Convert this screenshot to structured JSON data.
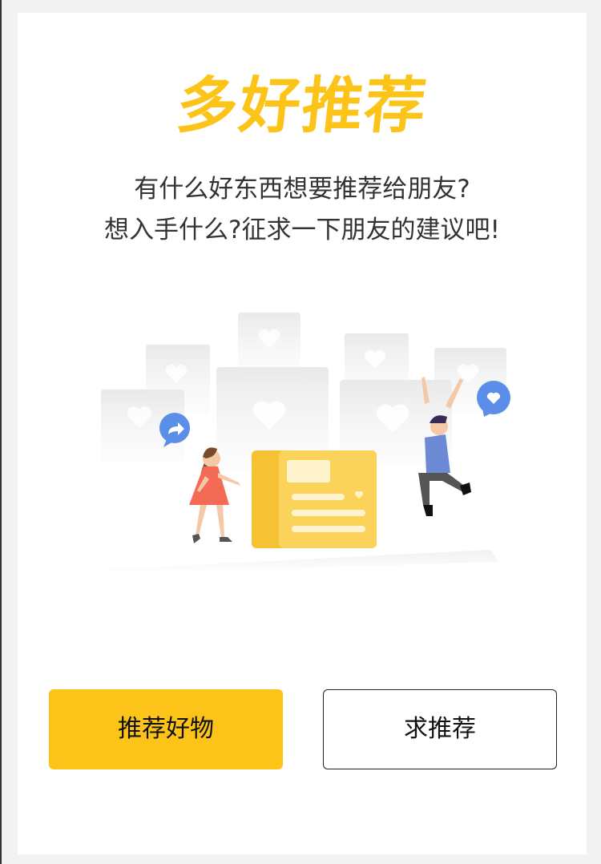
{
  "title": "多好推荐",
  "subtitle_line1": "有什么好东西想要推荐给朋友?",
  "subtitle_line2": "想入手什么?征求一下朋友的建议吧!",
  "buttons": {
    "recommend": "推荐好物",
    "ask": "求推荐"
  },
  "colors": {
    "accent": "#fcc419",
    "chat_bubble": "#5b8ee6",
    "background": "#f2f2f2"
  }
}
